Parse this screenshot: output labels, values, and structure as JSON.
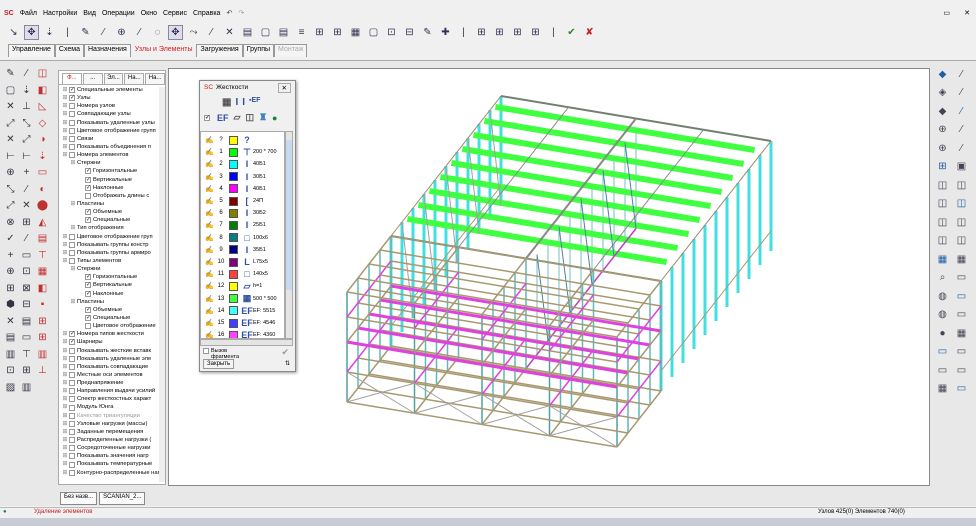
{
  "menu": [
    "Файл",
    "Настройки",
    "Вид",
    "Операции",
    "Окно",
    "Сервис",
    "Справка"
  ],
  "toolbar": {
    "apply_label": "✔",
    "cancel_label": "✘"
  },
  "tabs": [
    {
      "label": "Управление"
    },
    {
      "label": "Схема"
    },
    {
      "label": "Назначения"
    },
    {
      "label": "Узлы и Элементы",
      "active": true
    },
    {
      "label": "Загружения"
    },
    {
      "label": "Группы"
    },
    {
      "label": "Монтаж",
      "disabled": true
    }
  ],
  "tree": {
    "tabs": [
      "Ф...",
      "...",
      "Эл...",
      "На...",
      "На..."
    ],
    "items": [
      {
        "l": 0,
        "c": true,
        "t": "Специальные элементы"
      },
      {
        "l": 0,
        "c": true,
        "t": "Узлы"
      },
      {
        "l": 0,
        "c": false,
        "t": "Номера узлов"
      },
      {
        "l": 0,
        "c": false,
        "t": "Совпадающие узлы"
      },
      {
        "l": 0,
        "c": false,
        "t": "Показывать удаленные узлы"
      },
      {
        "l": 0,
        "c": false,
        "t": "Цветовое отображение групп"
      },
      {
        "l": 0,
        "c": false,
        "t": "Связи"
      },
      {
        "l": 0,
        "c": false,
        "t": "Показывать объединения п"
      },
      {
        "l": 0,
        "c": false,
        "t": "Номера элементов"
      },
      {
        "l": 1,
        "t": "Стержни"
      },
      {
        "l": 2,
        "c": true,
        "t": "Горизонтальные"
      },
      {
        "l": 2,
        "c": true,
        "t": "Вертикальные"
      },
      {
        "l": 2,
        "c": true,
        "t": "Наклонные"
      },
      {
        "l": 2,
        "c": false,
        "t": "Отображать длины с"
      },
      {
        "l": 1,
        "t": "Пластины"
      },
      {
        "l": 2,
        "c": true,
        "t": "Объемные"
      },
      {
        "l": 2,
        "c": true,
        "t": "Специальные"
      },
      {
        "l": 1,
        "t": "Тип отображения"
      },
      {
        "l": 0,
        "c": false,
        "t": "Цветовое отображение груп"
      },
      {
        "l": 0,
        "c": false,
        "t": "Показывать группы констр"
      },
      {
        "l": 0,
        "c": false,
        "t": "Показывать группы армиро"
      },
      {
        "l": 0,
        "c": false,
        "t": "Типы элементов"
      },
      {
        "l": 1,
        "t": "Стержни"
      },
      {
        "l": 2,
        "c": true,
        "t": "Горизонтальные"
      },
      {
        "l": 2,
        "c": true,
        "t": "Вертикальные"
      },
      {
        "l": 2,
        "c": true,
        "t": "Наклонные"
      },
      {
        "l": 1,
        "t": "Пластины"
      },
      {
        "l": 2,
        "c": true,
        "t": "Объемные"
      },
      {
        "l": 2,
        "c": true,
        "t": "Специальные"
      },
      {
        "l": 2,
        "c": false,
        "t": "Цветовое отображение"
      },
      {
        "l": 0,
        "c": true,
        "t": "Номера типов жесткости"
      },
      {
        "l": 0,
        "c": true,
        "t": "Шарниры"
      },
      {
        "l": 0,
        "c": false,
        "t": "Показывать жесткие вставк"
      },
      {
        "l": 0,
        "c": false,
        "t": "Показывать удаленные эле"
      },
      {
        "l": 0,
        "c": false,
        "t": "Показывать совпадающие"
      },
      {
        "l": 0,
        "c": false,
        "t": "Местные оси элементов"
      },
      {
        "l": 0,
        "c": false,
        "t": "Преднапряжение"
      },
      {
        "l": 0,
        "c": false,
        "t": "Направления выдачи усилий"
      },
      {
        "l": 0,
        "c": false,
        "t": "Спектр жесткостных характ"
      },
      {
        "l": 0,
        "c": false,
        "t": "Модуль Юнга"
      },
      {
        "l": 0,
        "c": false,
        "t": "Качество триангуляции",
        "g": true
      },
      {
        "l": 0,
        "c": false,
        "t": "Узловые нагрузки (массы)"
      },
      {
        "l": 0,
        "c": false,
        "t": "Заданные перемещения"
      },
      {
        "l": 0,
        "c": false,
        "t": "Распределенные нагрузки ("
      },
      {
        "l": 0,
        "c": false,
        "t": "Сосредоточенные нагрузки"
      },
      {
        "l": 0,
        "c": false,
        "t": "Показывать значения нагр"
      },
      {
        "l": 0,
        "c": false,
        "t": "Показывать температурные"
      },
      {
        "l": 0,
        "c": false,
        "t": "Контурно-распределенные нагр"
      }
    ]
  },
  "stiffness": {
    "title": "Жесткости",
    "fragment_label": "Вызов фрагмента",
    "close_label": "Закрыть",
    "rows": [
      {
        "n": "?",
        "color": "#ffff00",
        "icon": "?",
        "label": ""
      },
      {
        "n": "1",
        "color": "#00ff00",
        "icon": "⊤",
        "label": "200 * 700"
      },
      {
        "n": "2",
        "color": "#00ffff",
        "icon": "I",
        "label": "40Б1"
      },
      {
        "n": "3",
        "color": "#0000ff",
        "icon": "I",
        "label": "30Б1"
      },
      {
        "n": "4",
        "color": "#ff00ff",
        "icon": "I",
        "label": "40Б1"
      },
      {
        "n": "5",
        "color": "#800000",
        "icon": "[",
        "label": "24П"
      },
      {
        "n": "6",
        "color": "#808000",
        "icon": "I",
        "label": "30Б2"
      },
      {
        "n": "7",
        "color": "#008000",
        "icon": "I",
        "label": "25Б1"
      },
      {
        "n": "8",
        "color": "#008080",
        "icon": "□",
        "label": "100x6"
      },
      {
        "n": "9",
        "color": "#000080",
        "icon": "I",
        "label": "35Б1"
      },
      {
        "n": "10",
        "color": "#800080",
        "icon": "L",
        "label": "L75x5"
      },
      {
        "n": "11",
        "color": "#ff4040",
        "icon": "□",
        "label": "140x5"
      },
      {
        "n": "12",
        "color": "#ffff00",
        "icon": "▱",
        "label": "h=1"
      },
      {
        "n": "13",
        "color": "#40ff40",
        "icon": "▦",
        "label": "500 * 500"
      },
      {
        "n": "14",
        "color": "#40ffff",
        "icon": "EF",
        "label": "EF: 5515"
      },
      {
        "n": "15",
        "color": "#4040ff",
        "icon": "EF",
        "label": "EF: 4546"
      },
      {
        "n": "16",
        "color": "#ff40ff",
        "icon": "EF",
        "label": "EF: 4360"
      }
    ]
  },
  "doc_tabs": [
    "Без назв...",
    "SCANIAN_2..."
  ],
  "status": {
    "left": "Удаление элементов",
    "right": "Узлов 425(0) Элементов 740(0)"
  },
  "colors": {
    "column": "#40e0e0",
    "rafter": "#40ff40",
    "beam": "#e040e0",
    "brace": "#a89870"
  }
}
